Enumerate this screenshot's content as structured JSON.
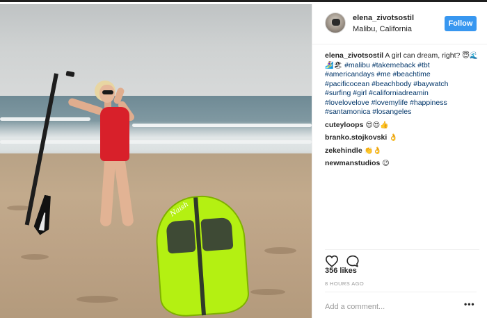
{
  "post": {
    "username": "elena_zivotsostil",
    "location": "Malibu, California",
    "follow_label": "Follow",
    "board_logo": "Naish"
  },
  "caption": {
    "username": "elena_zivotsostil",
    "text": "A girl can dream, right?",
    "emoji_1": "😇🌊",
    "emoji_2": "🏄‍♀️🏖",
    "hashtags": [
      "#malibu",
      "#takemeback",
      "#tbt",
      "#americandays",
      "#me",
      "#beachtime",
      "#pacificocean",
      "#beachbody",
      "#baywatch",
      "#surfing",
      "#girl",
      "#californiadreamin",
      "#lovelovelove",
      "#lovemylife",
      "#happiness",
      "#santamonica",
      "#losangeles"
    ]
  },
  "comments": [
    {
      "username": "cuteyloops",
      "text": "😍😍👍"
    },
    {
      "username": "branko.stojkovski",
      "text": "👌"
    },
    {
      "username": "zekehindle",
      "text": "👏👌"
    },
    {
      "username": "newmanstudios",
      "text": "😉"
    }
  ],
  "stats": {
    "likes": "356 likes",
    "time": "8 HOURS AGO"
  },
  "comment_box": {
    "placeholder": "Add a comment...",
    "more": "•••"
  },
  "icons": {
    "like": "heart-icon",
    "comment": "comment-bubble-icon",
    "more": "more-options-icon"
  },
  "colors": {
    "accent": "#3897f0",
    "hashtag": "#003569",
    "muted": "#999999"
  }
}
